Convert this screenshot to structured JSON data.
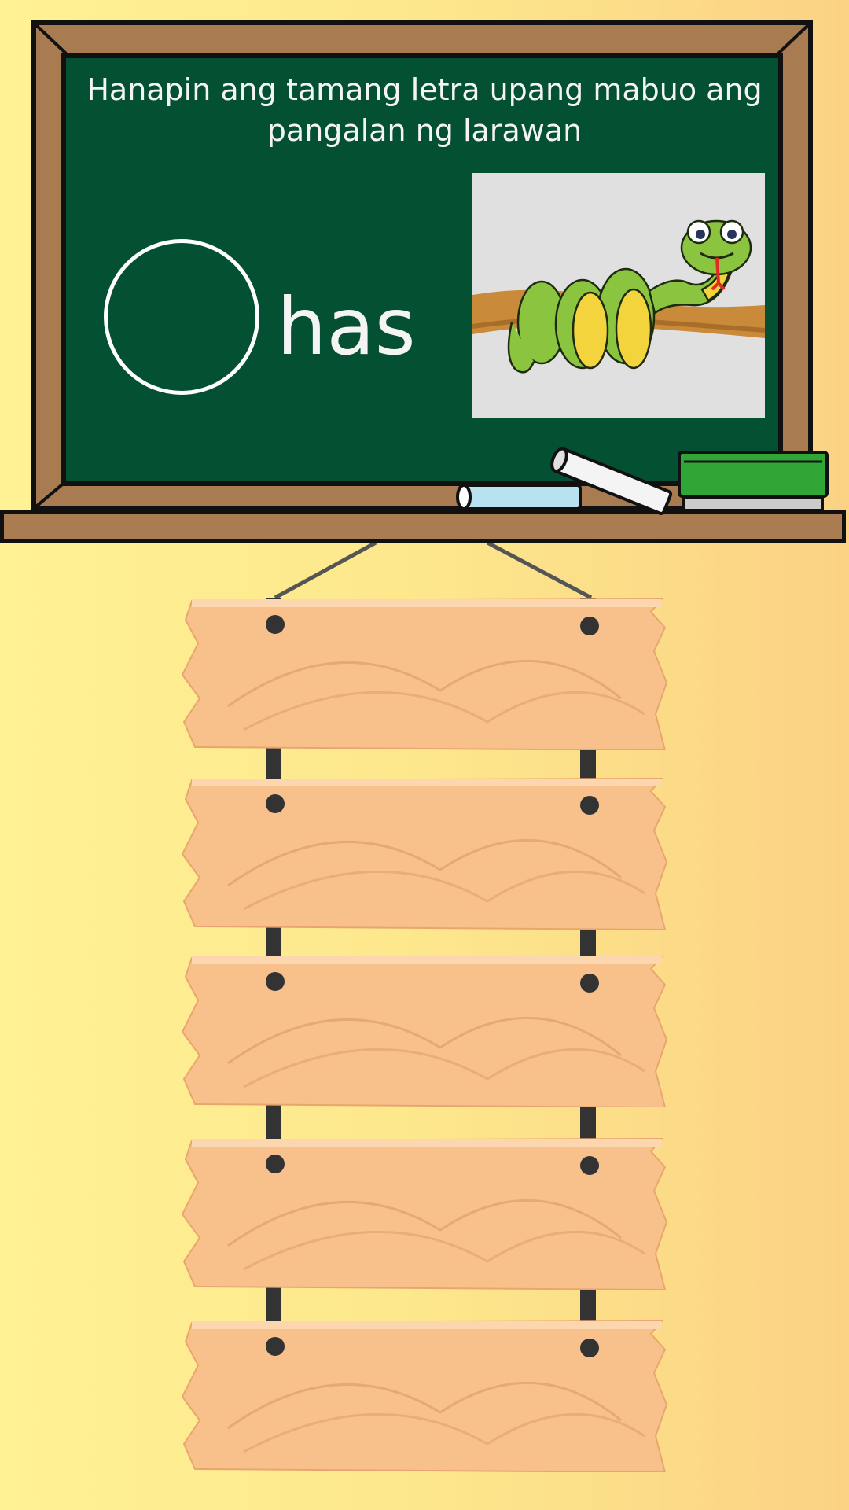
{
  "board": {
    "instruction_line1": "Hanapin ang tamang letra upang mabuo ang",
    "instruction_line2": "pangalan ng larawan",
    "word_suffix": "has",
    "answer_letter": ""
  },
  "picture": {
    "subject": "snake-on-branch"
  },
  "planks": [
    {
      "label": ""
    },
    {
      "label": ""
    },
    {
      "label": ""
    },
    {
      "label": ""
    },
    {
      "label": ""
    }
  ],
  "colors": {
    "board": "#035032",
    "frame": "#a87b50",
    "plank": "#f8c08a",
    "snake": "#8bc53f"
  }
}
